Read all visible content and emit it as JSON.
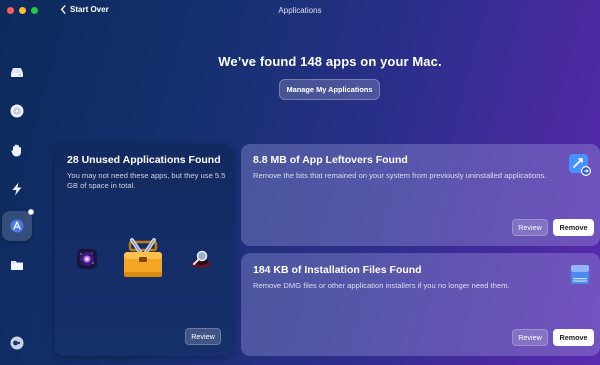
{
  "window": {
    "title": "Applications",
    "back_label": "Start Over"
  },
  "sidebar": {
    "items": [
      {
        "icon": "drive-icon"
      },
      {
        "icon": "shield-icon"
      },
      {
        "icon": "hand-icon"
      },
      {
        "icon": "lightning-icon"
      },
      {
        "icon": "applications-icon",
        "active": true
      },
      {
        "icon": "folder-icon"
      },
      {
        "icon": "toggle-icon"
      }
    ]
  },
  "main": {
    "headline": "We’ve found 148 apps on your Mac.",
    "manage_label": "Manage My Applications"
  },
  "cards": {
    "unused": {
      "title": "28 Unused Applications Found",
      "desc": "You may not need these apps, but they use 5.5 GB of space in total.",
      "review_label": "Review"
    },
    "leftovers": {
      "title": "8.8 MB of App Leftovers Found",
      "desc": "Remove the bits that remained on your system from previously uninstalled applications.",
      "review_label": "Review",
      "remove_label": "Remove"
    },
    "install": {
      "title": "184 KB of Installation Files Found",
      "desc": "Remove DMG files or other application installers if you no longer need them.",
      "review_label": "Review",
      "remove_label": "Remove"
    }
  },
  "colors": {
    "accent_blue": "#4a90ff",
    "toolbox_orange": "#f5a623"
  }
}
